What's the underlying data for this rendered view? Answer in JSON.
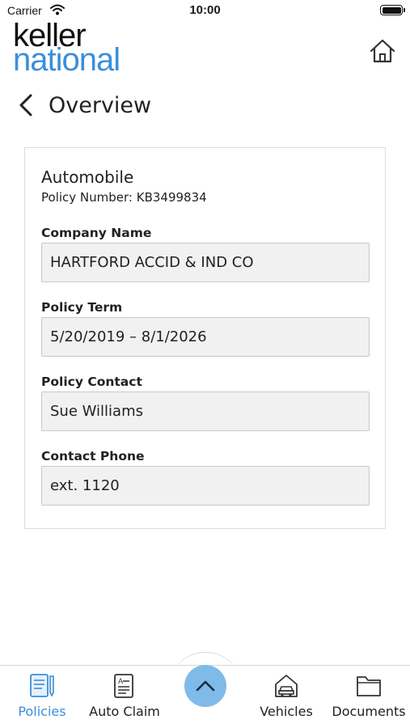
{
  "status_bar": {
    "carrier": "Carrier",
    "time": "10:00"
  },
  "header": {
    "logo_line1": "keller",
    "logo_line2": "national",
    "home_icon": "home-icon"
  },
  "nav": {
    "back_icon": "chevron-left-icon",
    "title": "Overview"
  },
  "policy": {
    "type": "Automobile",
    "number_text": "Policy Number: KB3499834",
    "fields": [
      {
        "label": "Company Name",
        "value": "HARTFORD ACCID & IND CO"
      },
      {
        "label": "Policy Term",
        "value": "5/20/2019 – 8/1/2026"
      },
      {
        "label": "Policy Contact",
        "value": "Sue Williams"
      },
      {
        "label": "Contact Phone",
        "value": "ext. 1120"
      }
    ]
  },
  "tab_bar": {
    "tabs": [
      {
        "label": "Policies",
        "icon": "policies-document-icon",
        "active": true
      },
      {
        "label": "Auto Claim",
        "icon": "auto-claim-form-icon",
        "active": false
      },
      {
        "label": "Vehicles",
        "icon": "car-garage-icon",
        "active": false
      },
      {
        "label": "Documents",
        "icon": "folder-icon",
        "active": false
      }
    ],
    "center_icon": "chevron-up-icon"
  },
  "colors": {
    "brand_blue": "#3a8fd9",
    "center_button": "#7fbbe8",
    "field_bg": "#f1f1f1"
  }
}
